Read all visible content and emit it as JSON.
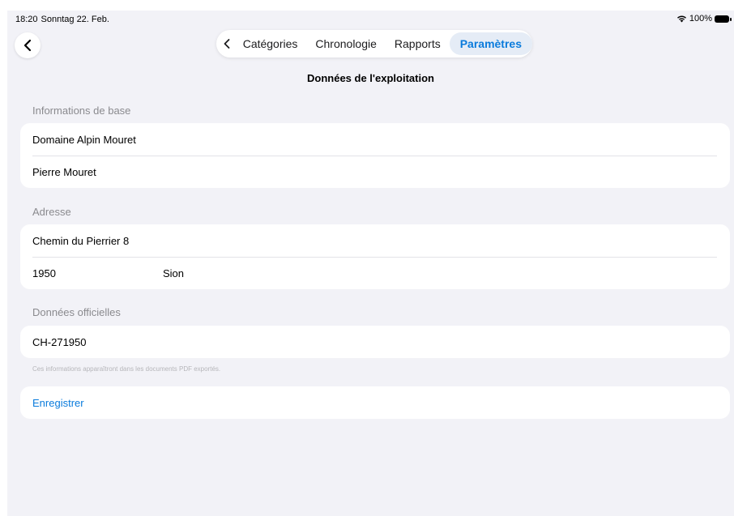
{
  "status_bar": {
    "time": "18:20",
    "date": "Sonntag 22. Feb.",
    "battery": "100%",
    "icons": [
      "wifi-icon",
      "battery-icon"
    ]
  },
  "nav": {
    "back_icon": "chevron-left-icon",
    "tabs": [
      {
        "label": "Catégories",
        "active": false
      },
      {
        "label": "Chronologie",
        "active": false
      },
      {
        "label": "Rapports",
        "active": false
      },
      {
        "label": "Paramètres",
        "active": true
      }
    ]
  },
  "page_title": "Données de l'exploitation",
  "sections": {
    "basic": {
      "header": "Informations de base",
      "farm_name": "Domaine Alpin Mouret",
      "owner_name": "Pierre Mouret"
    },
    "address": {
      "header": "Adresse",
      "street": "Chemin du Pierrier 8",
      "postcode": "1950",
      "city": "Sion"
    },
    "official": {
      "header": "Données officielles",
      "id": "CH-271950",
      "note": "Ces informations apparaîtront dans les documents PDF exportés."
    }
  },
  "save_label": "Enregistrer",
  "colors": {
    "accent": "#0a7bdc",
    "background": "#f2f2f7",
    "card": "#ffffff",
    "secondary_text": "#8a8a8e"
  }
}
